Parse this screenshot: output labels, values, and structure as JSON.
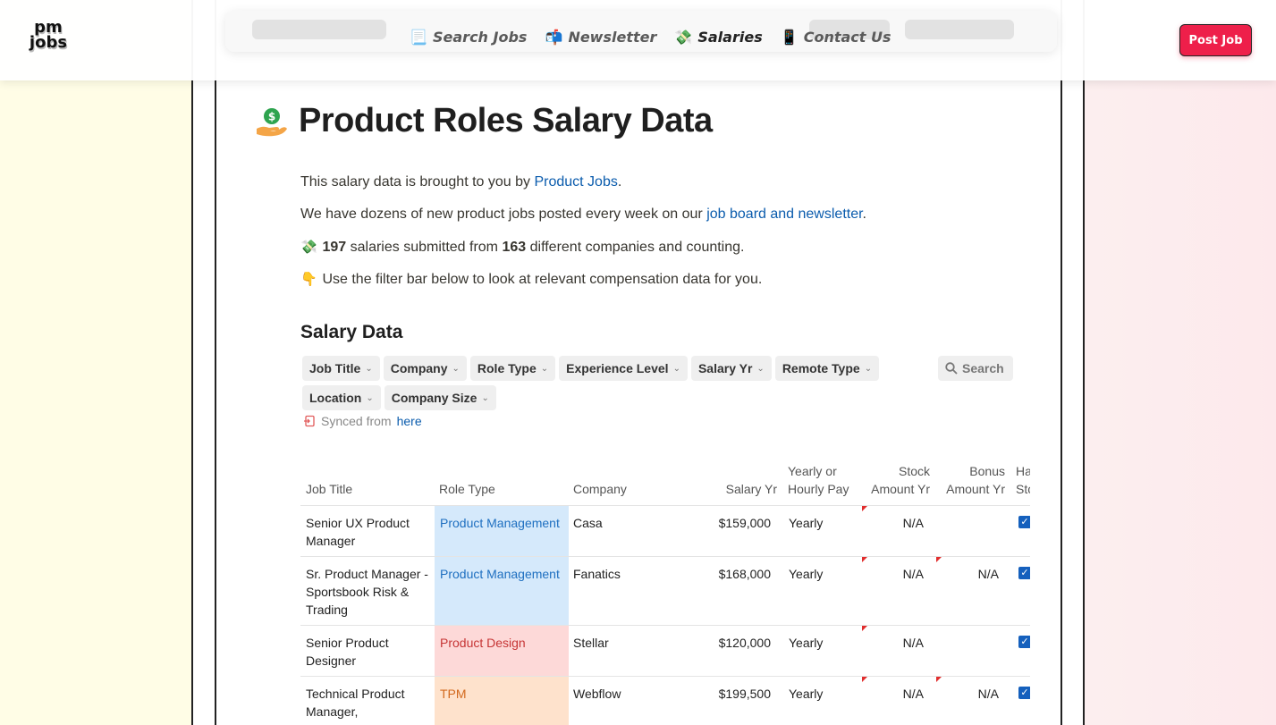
{
  "brand": {
    "logo_line1": "pm",
    "logo_line2": "jobs"
  },
  "nav": {
    "items": [
      {
        "icon": "📃",
        "label": "Search Jobs"
      },
      {
        "icon": "📬",
        "label": "Newsletter"
      },
      {
        "icon": "💸",
        "label": "Salaries"
      },
      {
        "icon": "📱",
        "label": "Contact Us"
      }
    ],
    "active": "Salaries",
    "post_job": "Post Job"
  },
  "page": {
    "icon": "money-hand-icon",
    "title": "Product Roles Salary Data"
  },
  "intro": {
    "line1_prefix": "This salary data is brought to you by ",
    "line1_link": "Product Jobs",
    "line1_suffix": ".",
    "line2_prefix": "We have dozens of new product jobs posted every week on our ",
    "line2_link": "job board and newsletter",
    "line2_suffix": ".",
    "line3_icon": "💸",
    "salaries_count": "197",
    "line3_mid": " salaries submitted from ",
    "companies_count": "163",
    "line3_suffix": " different companies and counting.",
    "line4_icon": "👇",
    "line4_text": "Use the filter bar below to look at relevant compensation data for you."
  },
  "salary_section": {
    "title": "Salary Data",
    "filters": [
      "Job Title",
      "Company",
      "Role Type",
      "Experience Level",
      "Salary Yr",
      "Remote Type",
      "Location",
      "Company Size"
    ],
    "search_label": "Search",
    "synced_prefix": "Synced from ",
    "synced_link": "here"
  },
  "table": {
    "columns": {
      "job_title": "Job Title",
      "role_type": "Role Type",
      "company": "Company",
      "salary_yr": "Salary Yr",
      "pay_type_1": "Yearly or",
      "pay_type_2": "Hourly Pay",
      "stock_1": "Stock",
      "stock_2": "Amount Yr",
      "bonus_1": "Bonus",
      "bonus_2": "Amount Yr",
      "has_stock_1": "Has",
      "has_stock_2": "Stock"
    },
    "rows": [
      {
        "job_title": "Senior UX Product Manager",
        "role_type": "Product Management",
        "role_color": "blue",
        "company": "Casa",
        "salary": "$159,000",
        "pay_type": "Yearly",
        "stock": "N/A",
        "bonus": "",
        "has_stock": true
      },
      {
        "job_title": "Sr. Product Manager - Sportsbook Risk & Trading",
        "role_type": "Product Management",
        "role_color": "blue",
        "company": "Fanatics",
        "salary": "$168,000",
        "pay_type": "Yearly",
        "stock": "N/A",
        "bonus": "N/A",
        "has_stock": true
      },
      {
        "job_title": "Senior Product Designer",
        "role_type": "Product Design",
        "role_color": "red",
        "company": "Stellar",
        "salary": "$120,000",
        "pay_type": "Yearly",
        "stock": "N/A",
        "bonus": "",
        "has_stock": true
      },
      {
        "job_title": "Technical Product Manager, Infrastructure",
        "role_type": "TPM",
        "role_color": "orange",
        "company": "Webflow",
        "salary": "$199,500",
        "pay_type": "Yearly",
        "stock": "N/A",
        "bonus": "N/A",
        "has_stock": true
      }
    ]
  }
}
